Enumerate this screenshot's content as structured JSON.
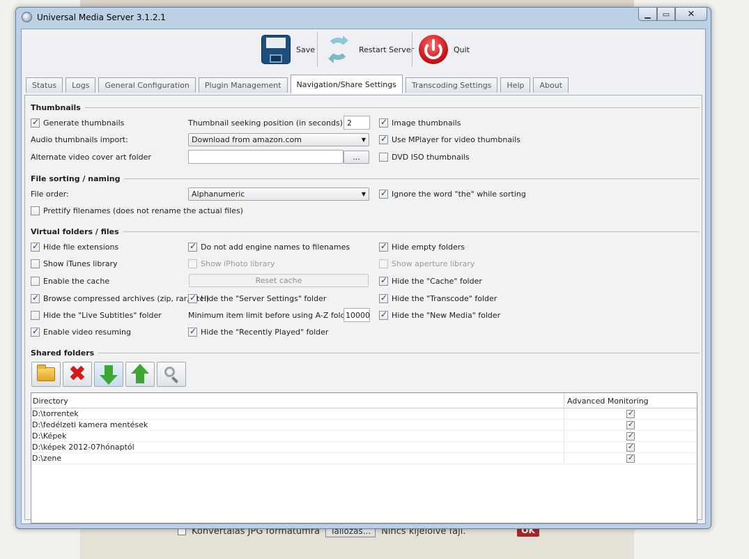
{
  "window": {
    "title": "Universal Media Server 3.1.2.1"
  },
  "toolbar": {
    "save": "Save",
    "restart": "Restart Server",
    "quit": "Quit"
  },
  "tabs": [
    {
      "label": "Status",
      "active": false
    },
    {
      "label": "Logs",
      "active": false
    },
    {
      "label": "General Configuration",
      "active": false
    },
    {
      "label": "Plugin Management",
      "active": false
    },
    {
      "label": "Navigation/Share Settings",
      "active": true
    },
    {
      "label": "Transcoding Settings",
      "active": false
    },
    {
      "label": "Help",
      "active": false
    },
    {
      "label": "About",
      "active": false
    }
  ],
  "thumbnails": {
    "title": "Thumbnails",
    "generate": {
      "label": "Generate thumbnails",
      "checked": true
    },
    "seek_label": "Thumbnail seeking position (in seconds):",
    "seek_value": "2",
    "image_thumbs": {
      "label": "Image thumbnails",
      "checked": true
    },
    "audio_label": "Audio thumbnails import:",
    "audio_value": "Download from amazon.com",
    "mplayer": {
      "label": "Use MPlayer for video thumbnails",
      "checked": true
    },
    "cover_label": "Alternate video cover art folder",
    "cover_value": "",
    "browse_button": "...",
    "dvd_iso": {
      "label": "DVD ISO thumbnails",
      "checked": false
    }
  },
  "sorting": {
    "title": "File sorting / naming",
    "order_label": "File order:",
    "order_value": "Alphanumeric",
    "ignore_the": {
      "label": "Ignore the word \"the\" while sorting",
      "checked": true
    },
    "prettify": {
      "label": "Prettify filenames (does not rename the actual files)",
      "checked": false
    }
  },
  "virtual": {
    "title": "Virtual folders / files",
    "hide_ext": {
      "label": "Hide file extensions",
      "checked": true
    },
    "no_engine": {
      "label": "Do not add engine names to filenames",
      "checked": true
    },
    "hide_empty": {
      "label": "Hide empty folders",
      "checked": true
    },
    "itunes": {
      "label": "Show iTunes library",
      "checked": false
    },
    "iphoto": {
      "label": "Show iPhoto library",
      "checked": false
    },
    "aperture": {
      "label": "Show aperture library",
      "checked": false
    },
    "cache": {
      "label": "Enable the cache",
      "checked": false
    },
    "reset_cache": "Reset cache",
    "hide_cache": {
      "label": "Hide the \"Cache\" folder",
      "checked": true
    },
    "archives": {
      "label": "Browse compressed archives (zip, rar, etc.)",
      "checked": true
    },
    "hide_server_settings": {
      "label": "Hide the \"Server Settings\" folder",
      "checked": true
    },
    "hide_transcode": {
      "label": "Hide the \"Transcode\" folder",
      "checked": true
    },
    "live_subs": {
      "label": "Hide the \"Live Subtitles\" folder",
      "checked": false
    },
    "az_label": "Minimum item limit before using A-Z folders:",
    "az_value": "10000",
    "hide_new_media": {
      "label": "Hide the \"New Media\" folder",
      "checked": true
    },
    "resume": {
      "label": "Enable video resuming",
      "checked": true
    },
    "hide_recent": {
      "label": "Hide the \"Recently Played\" folder",
      "checked": true
    }
  },
  "shared": {
    "title": "Shared folders",
    "columns": [
      "Directory",
      "Advanced Monitoring"
    ],
    "rows": [
      {
        "dir": "D:\\torrentek",
        "monitor": true
      },
      {
        "dir": "D:\\fedélzeti kamera mentések",
        "monitor": true
      },
      {
        "dir": "D:\\Képek",
        "monitor": true
      },
      {
        "dir": "D:\\képek 2012-07hónaptól",
        "monitor": true
      },
      {
        "dir": "D:\\zene",
        "monitor": true
      }
    ]
  },
  "background": {
    "checkbox_label": "Konvertálás JPG formátumra",
    "button_label": "Tallózás...",
    "status_text": "Nincs kijelölve fájl.",
    "ok_label": "OK"
  },
  "colors": {
    "accent": "#1d3f73",
    "window_frame": "#bcd0e6",
    "ok_red": "#a8262a"
  }
}
